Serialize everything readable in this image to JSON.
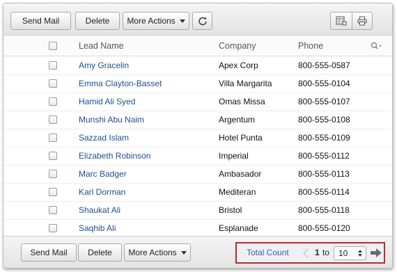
{
  "toolbar": {
    "send_mail": "Send Mail",
    "delete": "Delete",
    "more_actions": "More Actions"
  },
  "table": {
    "columns": {
      "lead_name": "Lead Name",
      "company": "Company",
      "phone": "Phone"
    },
    "rows": [
      {
        "lead": "Amy Gracelin",
        "company": "Apex Corp",
        "phone": "800-555-0587"
      },
      {
        "lead": "Emma Clayton-Basset",
        "company": "Villa Margarita",
        "phone": "800-555-0104"
      },
      {
        "lead": "Hamid Ali Syed",
        "company": "Omas Missa",
        "phone": "800-555-0107"
      },
      {
        "lead": "Munshi Abu Naim",
        "company": "Argentum",
        "phone": "800-555-0108"
      },
      {
        "lead": "Sazzad Islam",
        "company": "Hotel Punta",
        "phone": "800-555-0109"
      },
      {
        "lead": "Elizabeth Robinson",
        "company": "Imperial",
        "phone": "800-555-0112"
      },
      {
        "lead": "Marc Badger",
        "company": "Ambasador",
        "phone": "800-555-0113"
      },
      {
        "lead": "Karl Dorman",
        "company": "Mediteran",
        "phone": "800-555-0114"
      },
      {
        "lead": "Shaukat Ali",
        "company": "Bristol",
        "phone": "800-555-0118"
      },
      {
        "lead": "Saqhib Ali",
        "company": "Esplanade",
        "phone": "800-555-0120"
      }
    ]
  },
  "footer": {
    "send_mail": "Send Mail",
    "delete": "Delete",
    "more_actions": "More Actions"
  },
  "pager": {
    "total_count": "Total Count",
    "from": "1",
    "to_label": "to",
    "page_size": "10"
  },
  "colors": {
    "link": "#1f4e8c",
    "pager_highlight": "#c1272d",
    "total_count_link": "#3a62a8"
  },
  "icons": [
    "refresh-icon",
    "column-chooser-icon",
    "print-icon",
    "search-icon",
    "prev-arrow-icon",
    "next-arrow-icon",
    "spinner-icon"
  ]
}
